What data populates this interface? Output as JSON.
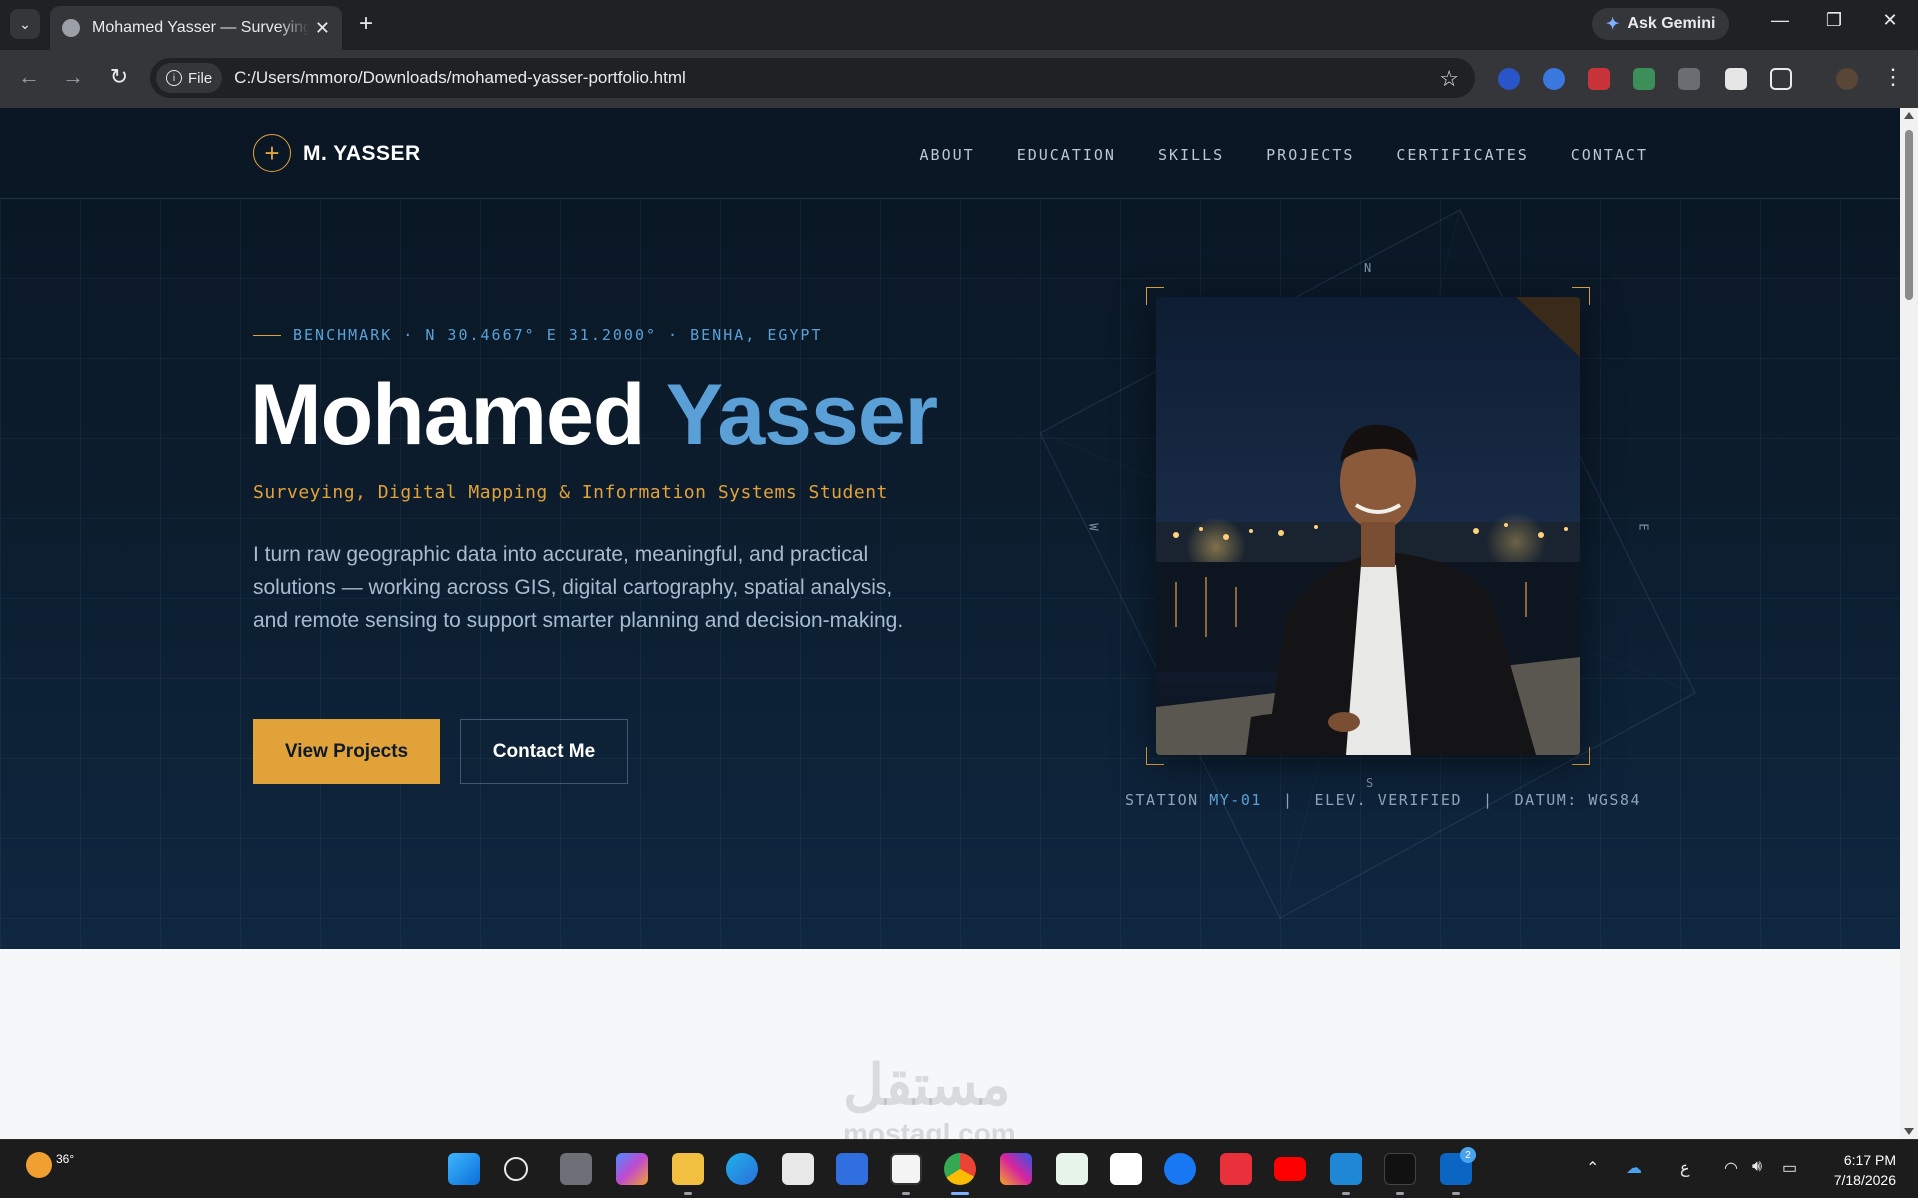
{
  "browser": {
    "tab_title": "Mohamed Yasser — Surveying & Digital Mapping",
    "new_tab_symbol": "+",
    "gemini_label": "Ask Gemini",
    "file_chip": "File",
    "url": "C:/Users/mmoro/Downloads/mohamed-yasser-portfolio.html"
  },
  "site": {
    "logo_text": "M. YASSER",
    "nav": [
      "ABOUT",
      "EDUCATION",
      "SKILLS",
      "PROJECTS",
      "CERTIFICATES",
      "CONTACT"
    ],
    "benchmark": "BENCHMARK · N 30.4667° E 31.2000° · BENHA, EGYPT",
    "name_first": "Mohamed",
    "name_last": "Yasser",
    "role": "Surveying, Digital Mapping & Information Systems Student",
    "intro": "I turn raw geographic data into accurate, meaningful, and practical solutions — working across GIS, digital cartography, spatial analysis, and remote sensing to support smarter planning and decision-making.",
    "btn_projects": "View Projects",
    "btn_contact": "Contact Me",
    "compass": {
      "n": "N",
      "s": "S",
      "e": "E",
      "w": "W"
    },
    "station_prefix": "STATION ",
    "station_id": "MY-01",
    "station_rest": "  |  ELEV. VERIFIED  |  DATUM: WGS84",
    "watermark": "مستقل",
    "watermark_sub": "mostaql.com"
  },
  "taskbar": {
    "temperature": "36°",
    "linkedin_badge": "2",
    "time": "6:17 PM",
    "date": "7/18/2026",
    "lang": "ع"
  },
  "colors": {
    "accent_gold": "#e2a23a",
    "accent_blue": "#5aa0d6",
    "hero_bg": "#0c1d2e"
  }
}
